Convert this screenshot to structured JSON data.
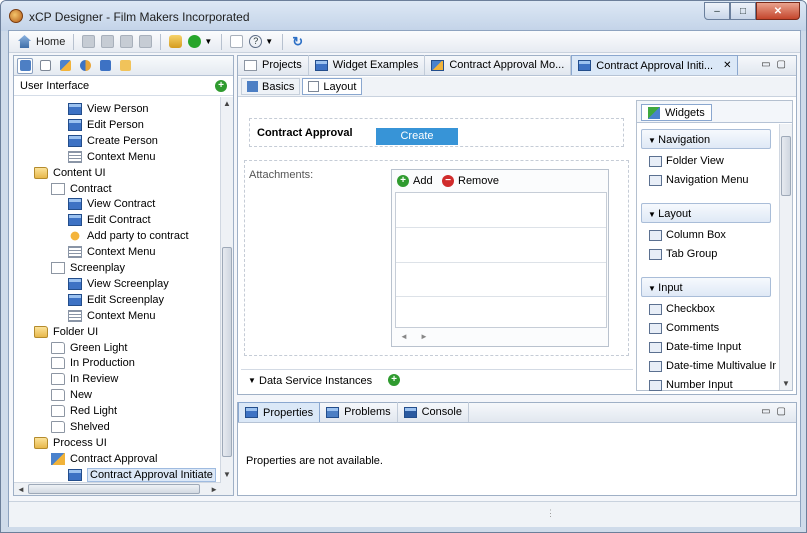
{
  "window": {
    "title": "xCP Designer - Film Makers Incorporated",
    "minimize": "–",
    "maximize": "□",
    "close": "✕"
  },
  "toolbar": {
    "home_label": "Home"
  },
  "left_panel": {
    "header": "User Interface",
    "tree": [
      {
        "label": "View Person",
        "icon": "screen-icon",
        "level": 3
      },
      {
        "label": "Edit Person",
        "icon": "screen-icon",
        "level": 3
      },
      {
        "label": "Create Person",
        "icon": "screen-icon",
        "level": 3
      },
      {
        "label": "Context Menu",
        "icon": "menu-icon",
        "level": 3
      },
      {
        "label": "Content UI",
        "icon": "folder-icon",
        "level": 1
      },
      {
        "label": "Contract",
        "icon": "page-icon",
        "level": 2
      },
      {
        "label": "View Contract",
        "icon": "screen-icon",
        "level": 3
      },
      {
        "label": "Edit Contract",
        "icon": "screen-icon",
        "level": 3
      },
      {
        "label": "Add party to contract",
        "icon": "action-icon",
        "level": 3
      },
      {
        "label": "Context Menu",
        "icon": "menu-icon",
        "level": 3
      },
      {
        "label": "Screenplay",
        "icon": "page-icon",
        "level": 2
      },
      {
        "label": "View Screenplay",
        "icon": "screen-icon",
        "level": 3
      },
      {
        "label": "Edit Screenplay",
        "icon": "screen-icon",
        "level": 3
      },
      {
        "label": "Context Menu",
        "icon": "menu-icon",
        "level": 3
      },
      {
        "label": "Folder UI",
        "icon": "folder-icon",
        "level": 1
      },
      {
        "label": "Green Light",
        "icon": "open-folder-icon",
        "level": 2
      },
      {
        "label": "In Production",
        "icon": "open-folder-icon",
        "level": 2
      },
      {
        "label": "In Review",
        "icon": "open-folder-icon",
        "level": 2
      },
      {
        "label": "New",
        "icon": "open-folder-icon",
        "level": 2
      },
      {
        "label": "Red Light",
        "icon": "open-folder-icon",
        "level": 2
      },
      {
        "label": "Shelved",
        "icon": "open-folder-icon",
        "level": 2
      },
      {
        "label": "Process UI",
        "icon": "folder-icon",
        "level": 1
      },
      {
        "label": "Contract Approval",
        "icon": "process-icon",
        "level": 2
      },
      {
        "label": "Contract Approval Initiate",
        "icon": "screen-icon",
        "level": 3,
        "selected": true
      }
    ]
  },
  "editor": {
    "tabs": [
      {
        "label": "Projects",
        "icon": "page-icon"
      },
      {
        "label": "Widget Examples",
        "icon": "screen-icon"
      },
      {
        "label": "Contract Approval Mo...",
        "icon": "process-icon"
      },
      {
        "label": "Contract Approval Initi...",
        "icon": "screen-icon",
        "active": true,
        "close": "✕"
      }
    ],
    "subtabs": [
      {
        "label": "Basics"
      },
      {
        "label": "Layout",
        "active": true
      }
    ],
    "form": {
      "title": "Contract Approval",
      "create_button": "Create",
      "attachments_label": "Attachments:",
      "add_label": "Add",
      "remove_label": "Remove",
      "data_service_label": "Data Service Instances"
    }
  },
  "widgets": {
    "tab": "Widgets",
    "sections": [
      {
        "label": "Navigation",
        "items": [
          "Folder View",
          "Navigation Menu"
        ]
      },
      {
        "label": "Layout",
        "items": [
          "Column Box",
          "Tab Group"
        ]
      },
      {
        "label": "Input",
        "items": [
          "Checkbox",
          "Comments",
          "Date-time Input",
          "Date-time Multivalue Input",
          "Number Input"
        ]
      }
    ]
  },
  "bottom": {
    "tabs": [
      {
        "label": "Properties",
        "active": true
      },
      {
        "label": "Problems"
      },
      {
        "label": "Console"
      }
    ],
    "message": "Properties are not available."
  }
}
